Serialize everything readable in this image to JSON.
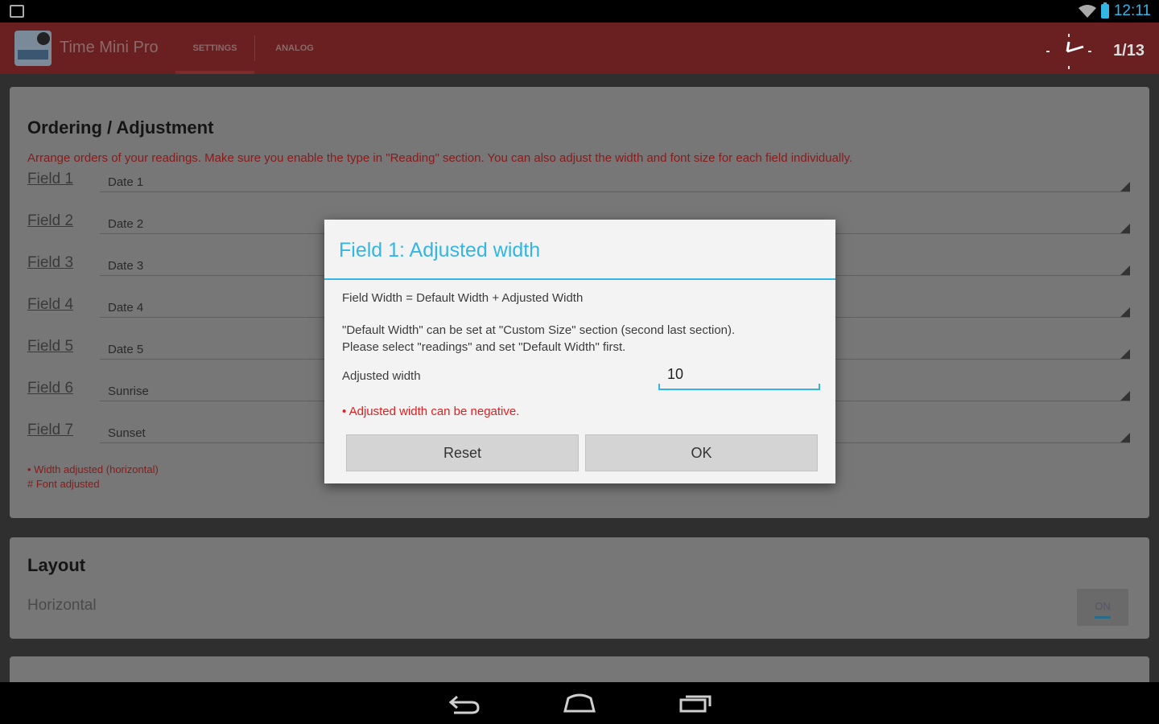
{
  "status_bar": {
    "time": "12:11"
  },
  "action_bar": {
    "app_title": "Time Mini Pro",
    "tabs": [
      {
        "label": "SETTINGS",
        "selected": true
      },
      {
        "label": "ANALOG",
        "selected": false
      }
    ],
    "page_counter": "1/13"
  },
  "ordering_section": {
    "title": "Ordering / Adjustment",
    "description": "Arrange orders of your readings. Make sure you enable the type in \"Reading\" section. You can also adjust the width and font size for each field individually.",
    "fields": [
      {
        "label": "Field 1",
        "value": "Date 1"
      },
      {
        "label": "Field 2",
        "value": "Date 2"
      },
      {
        "label": "Field 3",
        "value": "Date 3"
      },
      {
        "label": "Field 4",
        "value": "Date 4"
      },
      {
        "label": "Field 5",
        "value": "Date 5"
      },
      {
        "label": "Field 6",
        "value": "Sunrise"
      },
      {
        "label": "Field 7",
        "value": "Sunset"
      }
    ],
    "legend": [
      "• Width adjusted (horizontal)",
      "# Font adjusted"
    ]
  },
  "layout_section": {
    "title": "Layout",
    "item_label": "Horizontal",
    "toggle_label": "ON",
    "toggle_on": true
  },
  "dialog": {
    "title": "Field 1: Adjusted width",
    "formula": "Field Width = Default Width + Adjusted Width",
    "info_line_1": "\"Default Width\" can be set at \"Custom Size\" section (second last section).",
    "info_line_2": "Please select \"readings\" and set \"Default Width\" first.",
    "input_label": "Adjusted width",
    "input_value": "10",
    "note": "• Adjusted width can be negative.",
    "reset_label": "Reset",
    "ok_label": "OK"
  },
  "colors": {
    "accent": "#33b5e5",
    "action_bar": "#6a1f20",
    "error": "#e02020"
  }
}
